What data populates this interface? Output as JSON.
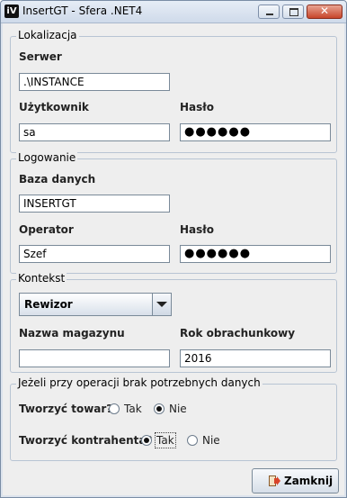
{
  "window": {
    "icon_text": "iV",
    "title": "InsertGT - Sfera .NET4",
    "close_glyph": "✕"
  },
  "lokalizacja": {
    "group_title": "Lokalizacja",
    "serwer_label": "Serwer",
    "serwer_value": ".\\INSTANCE",
    "uzytkownik_label": "Użytkownik",
    "uzytkownik_value": "sa",
    "haslo_label": "Hasło",
    "haslo_value": "●●●●●●"
  },
  "logowanie": {
    "group_title": "Logowanie",
    "baza_label": "Baza danych",
    "baza_value": "INSERTGT",
    "operator_label": "Operator",
    "operator_value": "Szef",
    "haslo_label": "Hasło",
    "haslo_value": "●●●●●●"
  },
  "kontekst": {
    "group_title": "Kontekst",
    "combo_value": "Rewizor",
    "magazyn_label": "Nazwa magazynu",
    "magazyn_value": "",
    "rok_label": "Rok obrachunkowy",
    "rok_value": "2016"
  },
  "brak_danych": {
    "group_title": "Jeżeli przy operacji brak potrzebnych danych",
    "towar_label": "Tworzyć towar?",
    "towar_tak": "Tak",
    "towar_nie": "Nie",
    "towar_selected": "Nie",
    "kontrahent_label": "Tworzyć kontrahenta?",
    "kontrahent_tak": "Tak",
    "kontrahent_nie": "Nie",
    "kontrahent_selected": "Tak"
  },
  "footer": {
    "close_button_label": "Zamknij",
    "close_button_icon": "exit-door-icon"
  },
  "colors": {
    "window_bg": "#eeeeee",
    "title_bar": "#cfdaea",
    "close_red": "#c7452a"
  }
}
